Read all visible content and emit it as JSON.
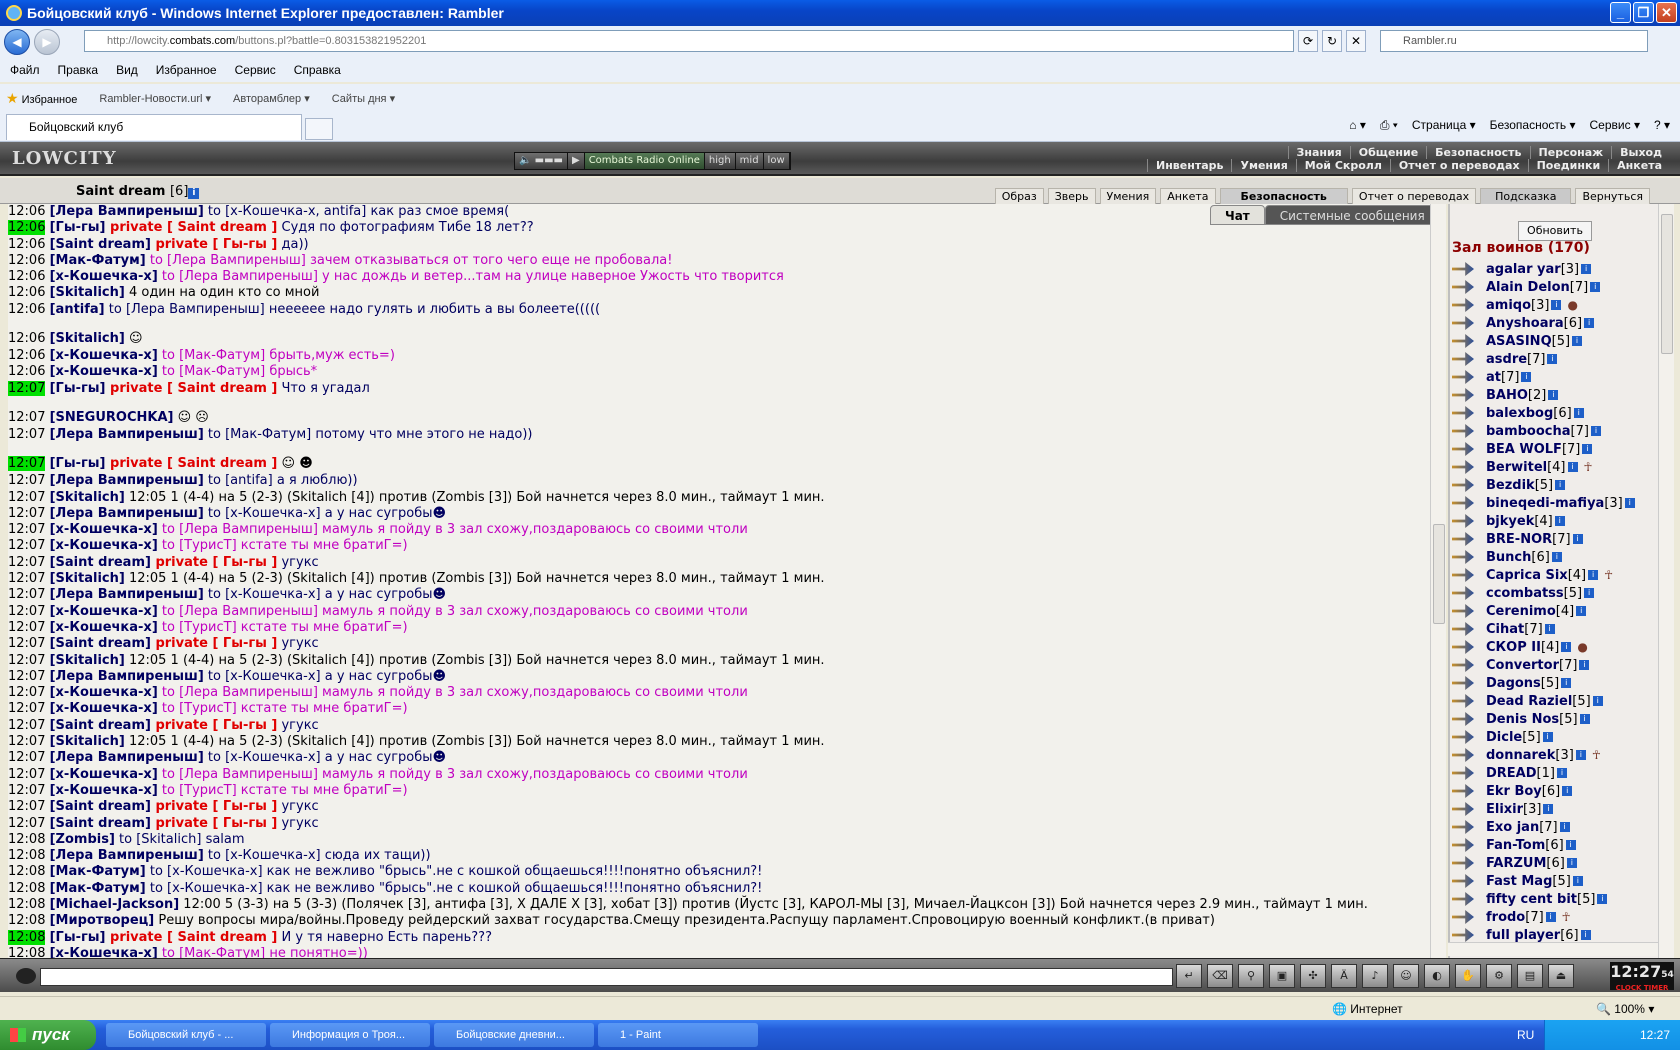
{
  "window": {
    "title": "Бойцовский клуб - Windows Internet Explorer предоставлен: Rambler"
  },
  "address": {
    "url_prefix": "http://lowcity.",
    "url_domain": "combats.com",
    "url_rest": "/buttons.pl?battle=0.803153821952201",
    "search": "Rambler.ru"
  },
  "menu": [
    "Файл",
    "Правка",
    "Вид",
    "Избранное",
    "Сервис",
    "Справка"
  ],
  "favorites": {
    "label": "Избранное",
    "links": [
      "Rambler-Новости.url ▾",
      "Авторамблер ▾",
      "Сайты дня ▾"
    ]
  },
  "tab": {
    "label": "Бойцовский клуб"
  },
  "commands": [
    "Страница ▾",
    "Безопасность ▾",
    "Сервис ▾"
  ],
  "game": {
    "logo": "LOWCITY",
    "radio": {
      "label": "Combats Radio Online",
      "high": "high",
      "mid": "mid",
      "low": "low"
    },
    "menu_row1": [
      "Знания",
      "Общение",
      "Безопасность",
      "Персонаж",
      "Выход"
    ],
    "menu_row2": [
      "Инвентарь",
      "Умения",
      "Мой Скролл",
      "Отчет о переводах",
      "Поединки",
      "Анкета"
    ],
    "char": {
      "name": "Saint dream",
      "level": "[6]"
    },
    "subtabs": [
      "Образ",
      "Зверь",
      "Умения",
      "Анкета",
      "Безопасность",
      "Отчет о переводах",
      "Подсказка",
      "Вернуться"
    ],
    "chat_tabs": [
      "Чат",
      "Системные сообщения"
    ]
  },
  "chat": [
    {
      "t": "12:06",
      "p": [
        [
          "who",
          "[Лера Вампиреныш]"
        ],
        [
          "to",
          " to [х-Кошечка-х, antifa] как раз смое время("
        ]
      ]
    },
    {
      "t": "12:06",
      "hl": true,
      "p": [
        [
          "who",
          "[Гы-гы]"
        ],
        [
          "priv",
          " private [ Saint dream ]"
        ],
        [
          "to",
          " Судя по фотографиям Тибе 18 лет??"
        ]
      ]
    },
    {
      "t": "12:06",
      "p": [
        [
          "who",
          "[Saint dream]"
        ],
        [
          "priv",
          " private [ Гы-гы ]"
        ],
        [
          "to",
          " да))"
        ]
      ]
    },
    {
      "t": "12:06",
      "p": [
        [
          "who",
          "[Мак-Фатум]"
        ],
        [
          "pink",
          " to [Лера Вампиреныш] зачем отказываться от того чего еще не пробовала!"
        ]
      ]
    },
    {
      "t": "12:06",
      "p": [
        [
          "who",
          "[х-Кошечка-х]"
        ],
        [
          "pink",
          " to [Лера Вампиреныш] у нас дождь и ветер...там на улице наверное Ужость что творится"
        ]
      ]
    },
    {
      "t": "12:06",
      "p": [
        [
          "who",
          "[Skitalich]"
        ],
        [
          "sys",
          " 4 один на один кто со мной"
        ]
      ]
    },
    {
      "t": "12:06",
      "p": [
        [
          "who",
          "[antifa]"
        ],
        [
          "to",
          " to [Лера Вампиреныш] неееееe надо гулять и любить а вы болеете((((("
        ]
      ]
    },
    {
      "t": "12:06",
      "tall": true,
      "p": [
        [
          "who",
          "[Skitalich]"
        ],
        [
          "sys",
          " ☺"
        ]
      ]
    },
    {
      "t": "12:06",
      "p": [
        [
          "who",
          "[х-Кошечка-х]"
        ],
        [
          "pink",
          " to [Мак-Фатум] брыть,муж есть=)"
        ]
      ]
    },
    {
      "t": "12:06",
      "p": [
        [
          "who",
          "[х-Кошечка-х]"
        ],
        [
          "pink",
          " to [Мак-Фатум] брысь*"
        ]
      ]
    },
    {
      "t": "12:07",
      "hl": true,
      "p": [
        [
          "who",
          "[Гы-гы]"
        ],
        [
          "priv",
          " private [ Saint dream ]"
        ],
        [
          "to",
          " Что я угадал"
        ]
      ]
    },
    {
      "t": "12:07",
      "tall": true,
      "p": [
        [
          "who",
          "[SNEGUROCHKA]"
        ],
        [
          "sys",
          " ☺ ☹"
        ]
      ]
    },
    {
      "t": "12:07",
      "p": [
        [
          "who",
          "[Лера Вампиреныш]"
        ],
        [
          "to",
          " to [Мак-Фатум] потому что мне этого не надо))"
        ]
      ]
    },
    {
      "t": "12:07",
      "hl": true,
      "tall": true,
      "p": [
        [
          "who",
          "[Гы-гы]"
        ],
        [
          "priv",
          " private [ Saint dream ]"
        ],
        [
          "sys",
          " ☺ ☻"
        ]
      ]
    },
    {
      "t": "12:07",
      "p": [
        [
          "who",
          "[Лера Вампиреныш]"
        ],
        [
          "to",
          " to [antifa] а я люблю))"
        ]
      ]
    },
    {
      "t": "12:07",
      "p": [
        [
          "who",
          "[Skitalich]"
        ],
        [
          "sys",
          " 12:05 1 (4-4) на 5 (2-3) (Skitalich [4]) против (Zombis [3]) Бой начнется через 8.0 мин., таймаут 1 мин."
        ]
      ]
    },
    {
      "t": "12:07",
      "p": [
        [
          "who",
          "[Лера Вампиреныш]"
        ],
        [
          "to",
          " to [х-Кошечка-х] а у нас сугробы☻"
        ]
      ]
    },
    {
      "t": "12:07",
      "p": [
        [
          "who",
          "[х-Кошечка-х]"
        ],
        [
          "pink",
          " to [Лера Вампиреныш] мамуль я пойду в 3 зал схожу,поздароваюсь со своими чтоли"
        ]
      ]
    },
    {
      "t": "12:07",
      "p": [
        [
          "who",
          "[х-Кошечка-х]"
        ],
        [
          "pink",
          " to [ТурисТ] кстате ты мне братиГ=)"
        ]
      ]
    },
    {
      "t": "12:07",
      "p": [
        [
          "who",
          "[Saint dream]"
        ],
        [
          "priv",
          " private [ Гы-гы ]"
        ],
        [
          "to",
          " угукс"
        ]
      ]
    },
    {
      "t": "12:07",
      "p": [
        [
          "who",
          "[Skitalich]"
        ],
        [
          "sys",
          " 12:05 1 (4-4) на 5 (2-3) (Skitalich [4]) против (Zombis [3]) Бой начнется через 8.0 мин., таймаут 1 мин."
        ]
      ]
    },
    {
      "t": "12:07",
      "p": [
        [
          "who",
          "[Лера Вампиреныш]"
        ],
        [
          "to",
          " to [х-Кошечка-х] а у нас сугробы☻"
        ]
      ]
    },
    {
      "t": "12:07",
      "p": [
        [
          "who",
          "[х-Кошечка-х]"
        ],
        [
          "pink",
          " to [Лера Вампиреныш] мамуль я пойду в 3 зал схожу,поздароваюсь со своими чтоли"
        ]
      ]
    },
    {
      "t": "12:07",
      "p": [
        [
          "who",
          "[х-Кошечка-х]"
        ],
        [
          "pink",
          " to [ТурисТ] кстате ты мне братиГ=)"
        ]
      ]
    },
    {
      "t": "12:07",
      "p": [
        [
          "who",
          "[Saint dream]"
        ],
        [
          "priv",
          " private [ Гы-гы ]"
        ],
        [
          "to",
          " угукс"
        ]
      ]
    },
    {
      "t": "12:07",
      "p": [
        [
          "who",
          "[Skitalich]"
        ],
        [
          "sys",
          " 12:05 1 (4-4) на 5 (2-3) (Skitalich [4]) против (Zombis [3]) Бой начнется через 8.0 мин., таймаут 1 мин."
        ]
      ]
    },
    {
      "t": "12:07",
      "p": [
        [
          "who",
          "[Лера Вампиреныш]"
        ],
        [
          "to",
          " to [х-Кошечка-х] а у нас сугробы☻"
        ]
      ]
    },
    {
      "t": "12:07",
      "p": [
        [
          "who",
          "[х-Кошечка-х]"
        ],
        [
          "pink",
          " to [Лера Вампиреныш] мамуль я пойду в 3 зал схожу,поздароваюсь со своими чтоли"
        ]
      ]
    },
    {
      "t": "12:07",
      "p": [
        [
          "who",
          "[х-Кошечка-х]"
        ],
        [
          "pink",
          " to [ТурисТ] кстате ты мне братиГ=)"
        ]
      ]
    },
    {
      "t": "12:07",
      "p": [
        [
          "who",
          "[Saint dream]"
        ],
        [
          "priv",
          " private [ Гы-гы ]"
        ],
        [
          "to",
          " угукс"
        ]
      ]
    },
    {
      "t": "12:07",
      "p": [
        [
          "who",
          "[Skitalich]"
        ],
        [
          "sys",
          " 12:05 1 (4-4) на 5 (2-3) (Skitalich [4]) против (Zombis [3]) Бой начнется через 8.0 мин., таймаут 1 мин."
        ]
      ]
    },
    {
      "t": "12:07",
      "p": [
        [
          "who",
          "[Лера Вампиреныш]"
        ],
        [
          "to",
          " to [х-Кошечка-х] а у нас сугробы☻"
        ]
      ]
    },
    {
      "t": "12:07",
      "p": [
        [
          "who",
          "[х-Кошечка-х]"
        ],
        [
          "pink",
          " to [Лера Вампиреныш] мамуль я пойду в 3 зал схожу,поздароваюсь со своими чтоли"
        ]
      ]
    },
    {
      "t": "12:07",
      "p": [
        [
          "who",
          "[х-Кошечка-х]"
        ],
        [
          "pink",
          " to [ТурисТ] кстате ты мне братиГ=)"
        ]
      ]
    },
    {
      "t": "12:07",
      "p": [
        [
          "who",
          "[Saint dream]"
        ],
        [
          "priv",
          " private [ Гы-гы ]"
        ],
        [
          "to",
          " угукс"
        ]
      ]
    },
    {
      "t": "12:07",
      "p": [
        [
          "who",
          "[Saint dream]"
        ],
        [
          "priv",
          " private [ Гы-гы ]"
        ],
        [
          "to",
          " угукс"
        ]
      ]
    },
    {
      "t": "12:08",
      "p": [
        [
          "who",
          "[Zombis]"
        ],
        [
          "to",
          " to [Skitalich] salam"
        ]
      ]
    },
    {
      "t": "12:08",
      "p": [
        [
          "who",
          "[Лера Вампиреныш]"
        ],
        [
          "to",
          " to [х-Кошечка-х] сюда их тащи))"
        ]
      ]
    },
    {
      "t": "12:08",
      "p": [
        [
          "who",
          "[Мак-Фатум]"
        ],
        [
          "to",
          " to [х-Кошечка-х] как не вежливо \"брысь\".не с кошкой общаешься!!!!понятно объяснил?!"
        ]
      ]
    },
    {
      "t": "12:08",
      "p": [
        [
          "who",
          "[Мак-Фатум]"
        ],
        [
          "to",
          " to [х-Кошечка-х] как не вежливо \"брысь\".не с кошкой общаешься!!!!понятно объяснил?!"
        ]
      ]
    },
    {
      "t": "12:08",
      "p": [
        [
          "who",
          "[Michael-Jackson]"
        ],
        [
          "sys",
          " 12:00 5 (3-3) на 5 (3-3) (Полячек [3], антифа [3], Х ДАЛЕ Х [3], хобат [3]) против (Йустс [3], КАРОЛ-МЫ [3], Мичаел-Йацксон [3]) Бой начнется через 2.9 мин., таймаут 1 мин."
        ]
      ]
    },
    {
      "t": "12:08",
      "p": [
        [
          "who",
          "[Миротворец]"
        ],
        [
          "sys",
          "      Решу вопросы мира/войны.Проведу рейдерский захват государства.Смещу президента.Распущу парламент.Спровоцирую военный конфликт.(в приват)"
        ]
      ]
    },
    {
      "t": "12:08",
      "hl": true,
      "p": [
        [
          "who",
          "[Гы-гы]"
        ],
        [
          "priv",
          " private [ Saint dream ]"
        ],
        [
          "to",
          " И у тя наверно Есть парень???"
        ]
      ]
    },
    {
      "t": "12:08",
      "p": [
        [
          "who",
          "[х-Кошечка-х]"
        ],
        [
          "pink",
          " to [Мак-Фатум] не понятно=))"
        ]
      ]
    }
  ],
  "side": {
    "refresh": "Обновить",
    "hall": "Зал воинов (170)",
    "users": [
      {
        "n": "agalar yar",
        "l": "[3]"
      },
      {
        "n": "Alain Delon",
        "l": "[7]"
      },
      {
        "n": "amiqo",
        "l": "[3]",
        "x": "●"
      },
      {
        "n": "Anyshoara",
        "l": "[6]"
      },
      {
        "n": "ASASINQ",
        "l": "[5]"
      },
      {
        "n": "asdre",
        "l": "[7]"
      },
      {
        "n": "at",
        "l": "[7]"
      },
      {
        "n": "BAHO",
        "l": "[2]"
      },
      {
        "n": "balexbog",
        "l": "[6]"
      },
      {
        "n": "bamboocha",
        "l": "[7]"
      },
      {
        "n": "BEA WOLF",
        "l": "[7]"
      },
      {
        "n": "Berwitel",
        "l": "[4]",
        "x": "☥"
      },
      {
        "n": "Bezdik",
        "l": "[5]"
      },
      {
        "n": "bineqedi-mafiya",
        "l": "[3]"
      },
      {
        "n": "bjkyek",
        "l": "[4]"
      },
      {
        "n": "BRE-NOR",
        "l": "[7]"
      },
      {
        "n": "Bunch",
        "l": "[6]"
      },
      {
        "n": "Caprica Six",
        "l": "[4]",
        "x": "☥"
      },
      {
        "n": "ccombatss",
        "l": "[5]"
      },
      {
        "n": "Cerenimo",
        "l": "[4]"
      },
      {
        "n": "Cihat",
        "l": "[7]"
      },
      {
        "n": "СКОР II",
        "l": "[4]",
        "x": "●"
      },
      {
        "n": "Convertor",
        "l": "[7]"
      },
      {
        "n": "Dagons",
        "l": "[5]"
      },
      {
        "n": "Dead Raziel",
        "l": "[5]"
      },
      {
        "n": "Denis Nos",
        "l": "[5]"
      },
      {
        "n": "Dicle",
        "l": "[5]"
      },
      {
        "n": "donnarek",
        "l": "[3]",
        "x": "☥"
      },
      {
        "n": "DREAD",
        "l": "[1]"
      },
      {
        "n": "Ekr Boy",
        "l": "[6]"
      },
      {
        "n": "Elixir",
        "l": "[3]"
      },
      {
        "n": "Exo jan",
        "l": "[7]"
      },
      {
        "n": "Fan-Tom",
        "l": "[6]"
      },
      {
        "n": "FARZUM",
        "l": "[6]"
      },
      {
        "n": "Fast Mag",
        "l": "[5]"
      },
      {
        "n": "fifty cent bit",
        "l": "[5]"
      },
      {
        "n": "frodo",
        "l": "[7]",
        "x": "☥"
      },
      {
        "n": "full player",
        "l": "[6]"
      }
    ]
  },
  "clock": {
    "time": "12:27",
    "sec": "54",
    "label": "CLOCK TIMER"
  },
  "status": {
    "zone": "Интернет",
    "zoom": "100%"
  },
  "taskbar": {
    "start": "пуск",
    "tasks": [
      "Бойцовский клуб - ...",
      "Информация о Троя...",
      "Бойцовские дневни...",
      "1 - Paint"
    ],
    "lang": "RU",
    "time": "12:27"
  }
}
